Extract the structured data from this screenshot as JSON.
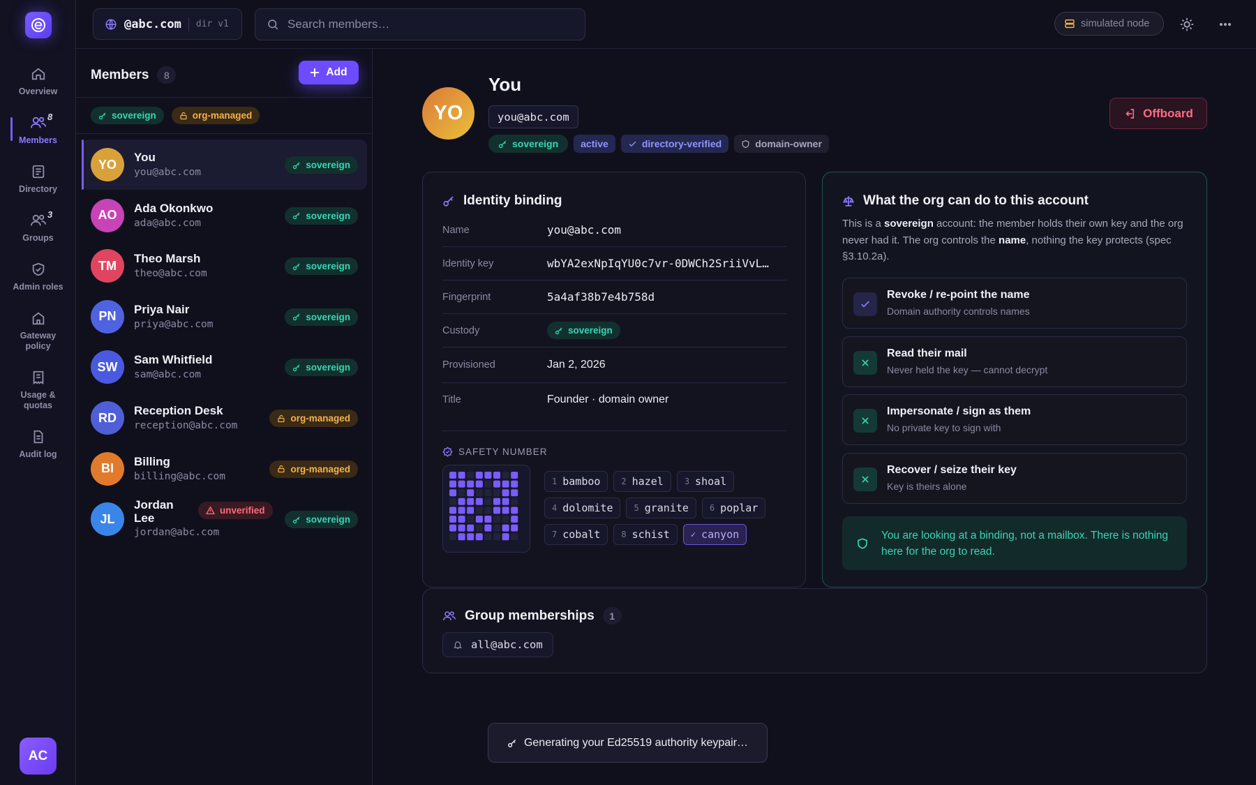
{
  "rail": {
    "items": [
      {
        "label": "Overview",
        "badge": ""
      },
      {
        "label": "Members",
        "badge": "8"
      },
      {
        "label": "Directory",
        "badge": ""
      },
      {
        "label": "Groups",
        "badge": "3"
      },
      {
        "label": "Admin roles",
        "badge": ""
      },
      {
        "label": "Gateway policy",
        "badge": ""
      },
      {
        "label": "Usage & quotas",
        "badge": ""
      },
      {
        "label": "Audit log",
        "badge": ""
      }
    ],
    "user_initials": "AC"
  },
  "topbar": {
    "domain": "@abc.com",
    "dir_version": "dir v1",
    "search_placeholder": "Search members…",
    "node_status": "simulated node"
  },
  "members": {
    "title": "Members",
    "count": "8",
    "add_label": "Add",
    "filters": [
      "sovereign",
      "org-managed"
    ],
    "list": [
      {
        "initials": "YO",
        "name": "You",
        "email": "you@abc.com",
        "tag": "sovereign",
        "tag_kind": "sov",
        "extra": "",
        "color": "#d9a13a"
      },
      {
        "initials": "AO",
        "name": "Ada Okonkwo",
        "email": "ada@abc.com",
        "tag": "sovereign",
        "tag_kind": "sov",
        "extra": "",
        "color": "#c842b8"
      },
      {
        "initials": "TM",
        "name": "Theo Marsh",
        "email": "theo@abc.com",
        "tag": "sovereign",
        "tag_kind": "sov",
        "extra": "",
        "color": "#e04560"
      },
      {
        "initials": "PN",
        "name": "Priya Nair",
        "email": "priya@abc.com",
        "tag": "sovereign",
        "tag_kind": "sov",
        "extra": "",
        "color": "#4f62e0"
      },
      {
        "initials": "SW",
        "name": "Sam Whitfield",
        "email": "sam@abc.com",
        "tag": "sovereign",
        "tag_kind": "sov",
        "extra": "",
        "color": "#4a5ae0"
      },
      {
        "initials": "RD",
        "name": "Reception Desk",
        "email": "reception@abc.com",
        "tag": "org-managed",
        "tag_kind": "org",
        "extra": "",
        "color": "#4f5fd8"
      },
      {
        "initials": "BI",
        "name": "Billing",
        "email": "billing@abc.com",
        "tag": "org-managed",
        "tag_kind": "org",
        "extra": "",
        "color": "#e27a2c"
      },
      {
        "initials": "JL",
        "name": "Jordan Lee",
        "email": "jordan@abc.com",
        "tag": "sovereign",
        "tag_kind": "sov",
        "extra": "unverified",
        "color": "#3a86e8"
      }
    ]
  },
  "profile": {
    "initials": "YO",
    "name": "You",
    "email": "you@abc.com",
    "tags": [
      "sovereign",
      "active",
      "directory-verified",
      "domain-owner"
    ],
    "offboard_label": "Offboard"
  },
  "identity": {
    "title": "Identity binding",
    "fields": [
      {
        "label": "Name",
        "value": "you@abc.com"
      },
      {
        "label": "Identity key",
        "value": "wbYA2exNpIqYU0c7vr-0DWCh2SriiVvL…"
      },
      {
        "label": "Fingerprint",
        "value": "5a4af38b7e4b758d"
      },
      {
        "label": "Custody",
        "value": "sovereign"
      },
      {
        "label": "Provisioned",
        "value": "Jan 2, 2026"
      },
      {
        "label": "Title",
        "value": "Founder · domain owner"
      }
    ],
    "safety_label": "SAFETY NUMBER",
    "words": [
      {
        "n": "1",
        "w": "bamboo"
      },
      {
        "n": "2",
        "w": "hazel"
      },
      {
        "n": "3",
        "w": "shoal"
      },
      {
        "n": "4",
        "w": "dolomite"
      },
      {
        "n": "5",
        "w": "granite"
      },
      {
        "n": "6",
        "w": "poplar"
      },
      {
        "n": "7",
        "w": "cobalt"
      },
      {
        "n": "8",
        "w": "schist"
      },
      {
        "n": "✓",
        "w": "canyon"
      }
    ]
  },
  "org": {
    "title": "What the org can do to this account",
    "desc_pre": "This is a ",
    "desc_b1": "sovereign",
    "desc_mid": " account: the member holds their own key and the org never had it. The org controls the ",
    "desc_b2": "name",
    "desc_post": ", nothing the key protects (spec §3.10.2a).",
    "perms": [
      {
        "title": "Revoke / re-point the name",
        "sub": "Domain authority controls names",
        "allowed": true
      },
      {
        "title": "Read their mail",
        "sub": "Never held the key — cannot decrypt",
        "allowed": false
      },
      {
        "title": "Impersonate / sign as them",
        "sub": "No private key to sign with",
        "allowed": false
      },
      {
        "title": "Recover / seize their key",
        "sub": "Key is theirs alone",
        "allowed": false
      }
    ],
    "notice": "You are looking at a binding, not a mailbox. There is nothing here for the org to read."
  },
  "groups": {
    "title": "Group memberships",
    "count": "1",
    "items": [
      "all@abc.com"
    ]
  },
  "toast": "Generating your Ed25519 authority keypair…"
}
